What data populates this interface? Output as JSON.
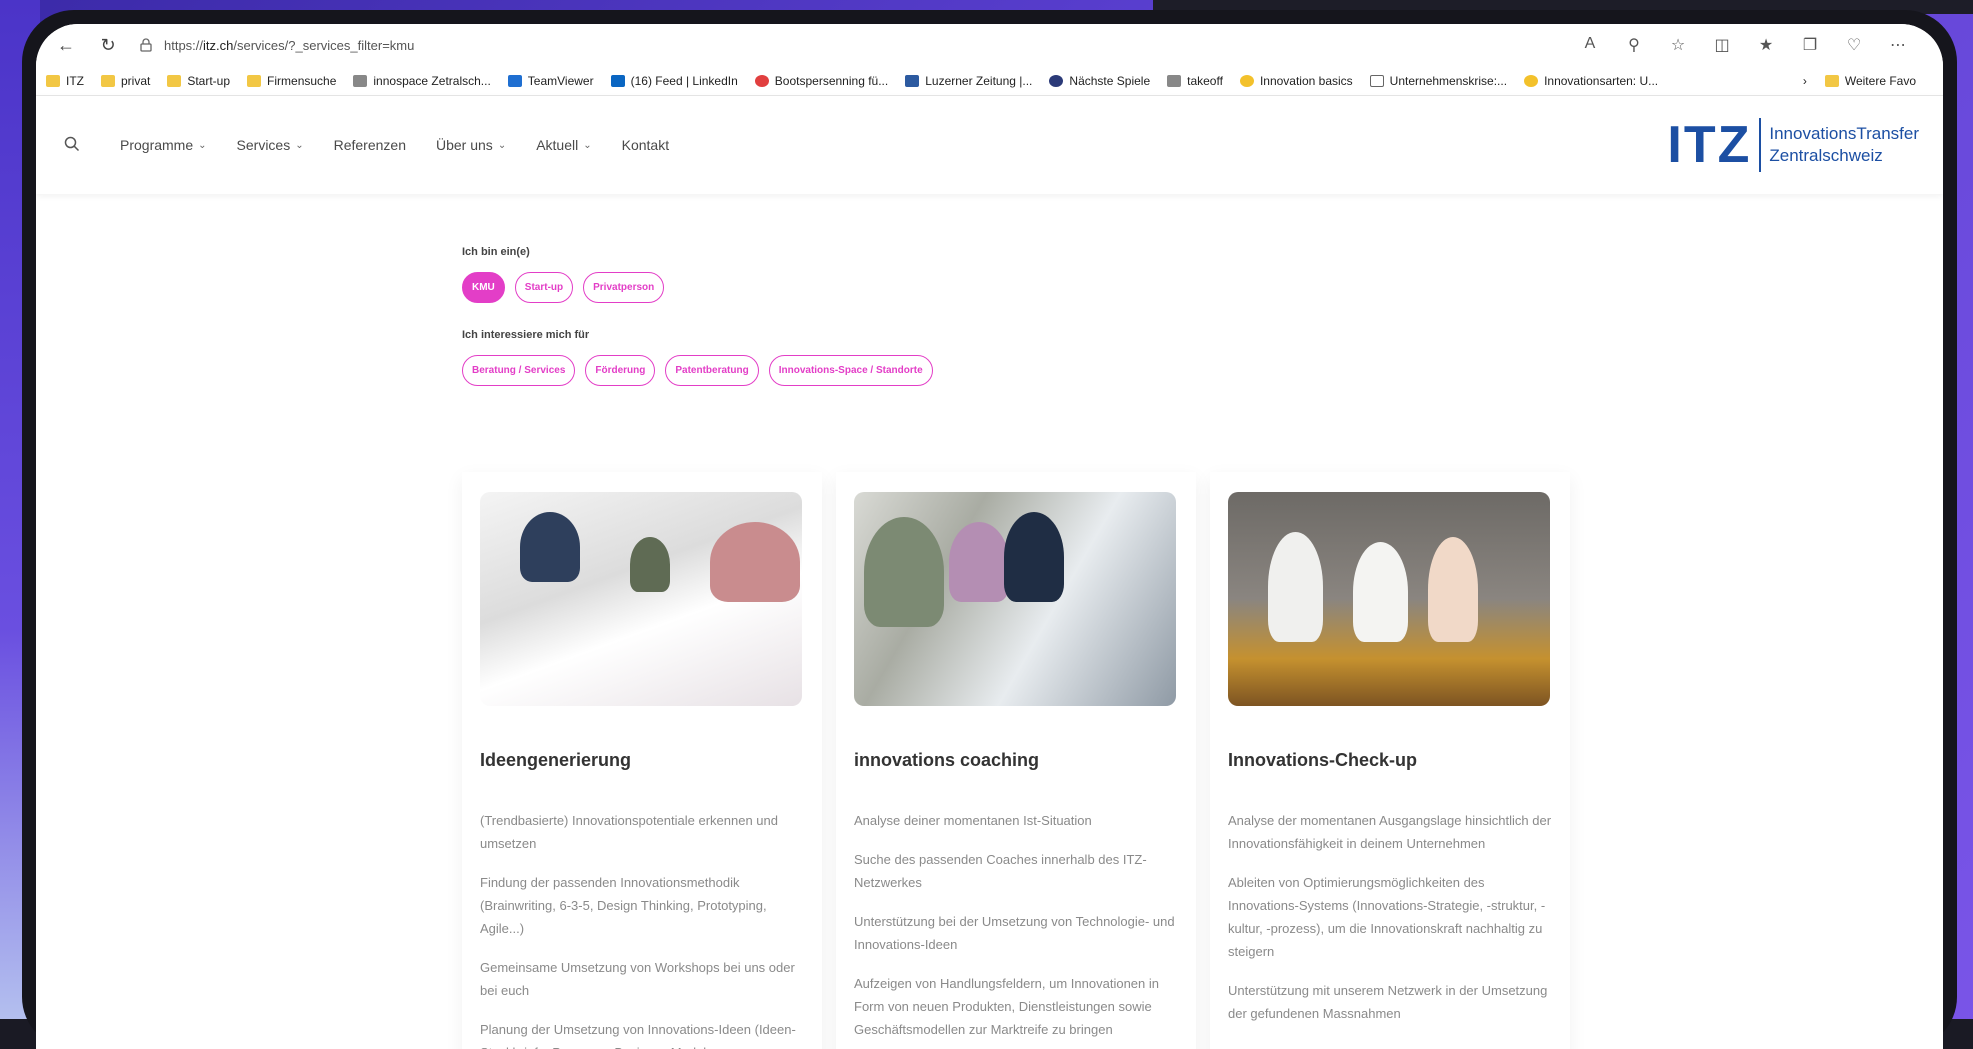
{
  "browser": {
    "url_prefix": "https://",
    "url_host": "itz.ch",
    "url_path": "/services/?_services_filter=kmu",
    "bookmarks": [
      {
        "label": "ITZ",
        "icon": "folder"
      },
      {
        "label": "privat",
        "icon": "folder"
      },
      {
        "label": "Start-up",
        "icon": "folder"
      },
      {
        "label": "Firmensuche",
        "icon": "folder"
      },
      {
        "label": "innospace Zetralsch...",
        "icon": "grey"
      },
      {
        "label": "TeamViewer",
        "icon": "blue"
      },
      {
        "label": "(16) Feed | LinkedIn",
        "icon": "li"
      },
      {
        "label": "Bootspersenning fü...",
        "icon": "red"
      },
      {
        "label": "Luzerner Zeitung |...",
        "icon": "lz"
      },
      {
        "label": "Nächste Spiele",
        "icon": "dark"
      },
      {
        "label": "takeoff",
        "icon": "grey"
      },
      {
        "label": "Innovation basics",
        "icon": "yel"
      },
      {
        "label": "Unternehmenskrise:...",
        "icon": "doc"
      },
      {
        "label": "Innovationsarten: U...",
        "icon": "yel"
      }
    ],
    "more_bookmarks": "Weitere Favo"
  },
  "site": {
    "nav": [
      {
        "label": "Programme",
        "dropdown": true
      },
      {
        "label": "Services",
        "dropdown": true
      },
      {
        "label": "Referenzen",
        "dropdown": false
      },
      {
        "label": "Über uns",
        "dropdown": true
      },
      {
        "label": "Aktuell",
        "dropdown": true
      },
      {
        "label": "Kontakt",
        "dropdown": false
      }
    ],
    "logo": {
      "mark": "ITZ",
      "line1": "InnovationsTransfer",
      "line2": "Zentralschweiz"
    }
  },
  "filters": {
    "role_label": "Ich bin ein(e)",
    "roles": [
      "KMU",
      "Start-up",
      "Privatperson"
    ],
    "active_role": "KMU",
    "interest_label": "Ich interessiere mich für",
    "interests": [
      "Beratung / Services",
      "Förderung",
      "Patentberatung",
      "Innovations-Space / Standorte"
    ]
  },
  "cards": [
    {
      "title": "Ideengenerierung",
      "paragraphs": [
        "(Trendbasierte) Innovationspotentiale erkennen und umsetzen",
        "Findung der passenden Innovationsmethodik (Brainwriting, 6-3-5, Design Thinking, Prototyping, Agile...)",
        "Gemeinsame Umsetzung von Workshops bei uns oder bei euch",
        "Planung der Umsetzung von Innovations-Ideen (Ideen-Steckbriefe, Personas, Business Model"
      ]
    },
    {
      "title": "innovations coaching",
      "paragraphs": [
        "Analyse deiner momentanen Ist-Situation",
        "Suche des passenden Coaches innerhalb des ITZ-Netzwerkes",
        "Unterstützung bei der Umsetzung von Technologie- und Innovations-Ideen",
        "Aufzeigen von Handlungsfeldern, um Innovationen in Form von neuen Produkten, Dienstleistungen sowie Geschäftsmodellen zur Marktreife zu bringen"
      ]
    },
    {
      "title": "Innovations-Check-up",
      "paragraphs": [
        "Analyse der momentanen Ausgangslage hinsichtlich der Innovationsfähigkeit in deinem Unternehmen",
        "Ableiten von Optimierungsmöglichkeiten des Innovations-Systems (Innovations-Strategie, -struktur, -kultur, -prozess), um die Innovationskraft nachhaltig zu steigern",
        "Unterstützung mit unserem Netzwerk in der Umsetzung der gefundenen Massnahmen"
      ]
    }
  ],
  "colors": {
    "accent": "#e33ec7",
    "brand": "#1c4fa3"
  }
}
